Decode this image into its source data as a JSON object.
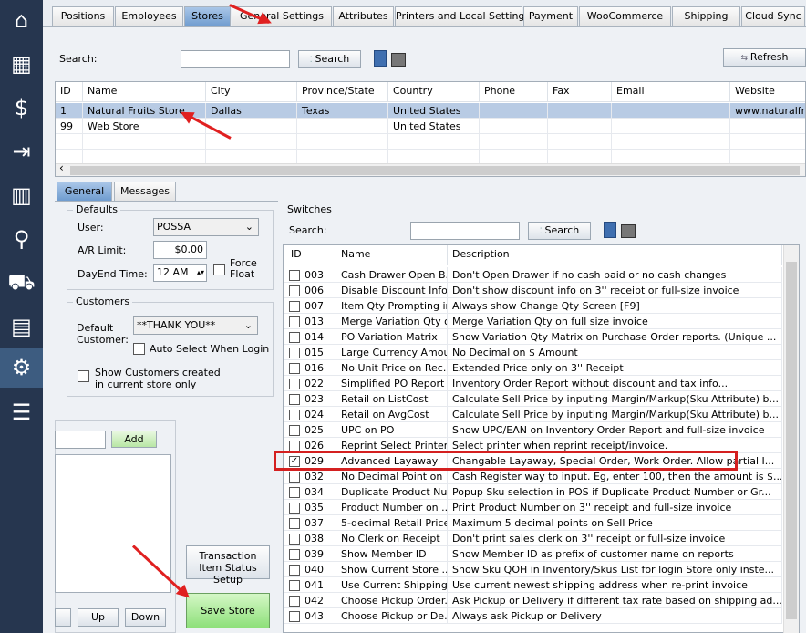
{
  "sidebar": {
    "items": [
      {
        "name": "home-icon",
        "glyph": "⌂"
      },
      {
        "name": "register-icon",
        "glyph": "▦"
      },
      {
        "name": "invoice-icon",
        "glyph": "$"
      },
      {
        "name": "signout-icon",
        "glyph": "⇥"
      },
      {
        "name": "building-icon",
        "glyph": "▥"
      },
      {
        "name": "walker-icon",
        "glyph": "⚲"
      },
      {
        "name": "delivery-icon",
        "glyph": "⛟"
      },
      {
        "name": "report-icon",
        "glyph": "▤"
      },
      {
        "name": "settings-icon",
        "glyph": "⚙"
      },
      {
        "name": "menu-icon",
        "glyph": "☰"
      }
    ]
  },
  "tabs": [
    "Positions",
    "Employees",
    "Stores",
    "General Settings",
    "Attributes",
    "Printers and Local Settings",
    "Payment",
    "WooCommerce",
    "Shipping",
    "Cloud Sync"
  ],
  "search_label": "Search:",
  "search_button": "Search",
  "refresh_button": "Refresh",
  "stores_table": {
    "columns": [
      "ID",
      "Name",
      "City",
      "Province/State",
      "Country",
      "Phone",
      "Fax",
      "Email",
      "Website"
    ],
    "rows": [
      [
        "1",
        "Natural Fruits Store",
        "Dallas",
        "Texas",
        "United States",
        "",
        "",
        "",
        "www.naturalfruits"
      ],
      [
        "99",
        "Web Store",
        "",
        "",
        "United States",
        "",
        "",
        "",
        ""
      ]
    ]
  },
  "subtabs": [
    "General",
    "Messages"
  ],
  "defaults": {
    "title": "Defaults",
    "user_label": "User:",
    "user_value": "POSSA",
    "ar_label": "A/R Limit:",
    "ar_value": "$0.00",
    "dayend_label": "DayEnd Time:",
    "dayend_value": "12 AM",
    "force_float": "Force Float"
  },
  "customers": {
    "title": "Customers",
    "default_label": "Default Customer:",
    "default_value": "**THANK YOU**",
    "auto_select": "Auto Select When Login",
    "show_customers": "Show Customers created in current store only"
  },
  "add_button": "Add",
  "up_button": "Up",
  "down_button": "Down",
  "transaction_button": "Transaction Item Status Setup",
  "save_button": "Save Store",
  "switches": {
    "title": "Switches",
    "search_label": "Search:",
    "search_button": "Search",
    "columns": [
      "ID",
      "Name",
      "Description"
    ],
    "rows": [
      {
        "checked": false,
        "id": "003",
        "name": "Cash Drawer Open B...",
        "desc": "Don't Open Drawer if no cash paid or no cash changes"
      },
      {
        "checked": false,
        "id": "006",
        "name": "Disable Discount Info",
        "desc": "Don't show discount info on 3'' receipt or full-size invoice"
      },
      {
        "checked": false,
        "id": "007",
        "name": "Item Qty Prompting in...",
        "desc": "Always show Change Qty Screen [F9]"
      },
      {
        "checked": false,
        "id": "013",
        "name": "Merge Variation Qty o...",
        "desc": "Merge Variation Qty on full size invoice"
      },
      {
        "checked": false,
        "id": "014",
        "name": "PO Variation Matrix",
        "desc": "Show Variation Qty Matrix on Purchase Order reports. (Unique ..."
      },
      {
        "checked": false,
        "id": "015",
        "name": "Large Currency Amount",
        "desc": "No Decimal on $ Amount"
      },
      {
        "checked": false,
        "id": "016",
        "name": "No Unit Price on Rec...",
        "desc": "Extended Price only on 3'' Receipt"
      },
      {
        "checked": false,
        "id": "022",
        "name": "Simplified PO Report",
        "desc": "Inventory Order Report without discount and tax info..."
      },
      {
        "checked": false,
        "id": "023",
        "name": "Retail on ListCost",
        "desc": "Calculate Sell Price by inputing Margin/Markup(Sku Attribute) b..."
      },
      {
        "checked": false,
        "id": "024",
        "name": "Retail on AvgCost",
        "desc": "Calculate Sell Price by inputing Margin/Markup(Sku Attribute) b..."
      },
      {
        "checked": false,
        "id": "025",
        "name": "UPC on PO",
        "desc": "Show UPC/EAN on Inventory Order Report and full-size invoice"
      },
      {
        "checked": false,
        "id": "026",
        "name": "Reprint Select Printer",
        "desc": "Select printer when reprint receipt/invoice."
      },
      {
        "checked": true,
        "id": "029",
        "name": "Advanced Layaway",
        "desc": "Changable Layaway, Special Order, Work Order. Allow partial I..."
      },
      {
        "checked": false,
        "id": "032",
        "name": "No Decimal Point on ...",
        "desc": "Cash Register way to input. Eg, enter 100, then the amount is $..."
      },
      {
        "checked": false,
        "id": "034",
        "name": "Duplicate Product Nu...",
        "desc": "Popup Sku selection in POS if Duplicate Product Number or Gr..."
      },
      {
        "checked": false,
        "id": "035",
        "name": "Product Number on ...",
        "desc": "Print Product Number on 3'' receipt and full-size invoice"
      },
      {
        "checked": false,
        "id": "037",
        "name": "5-decimal Retail Price",
        "desc": "Maximum 5 decimal points on Sell Price"
      },
      {
        "checked": false,
        "id": "038",
        "name": "No Clerk on Receipt",
        "desc": "Don't print sales clerk on 3'' receipt or full-size invoice"
      },
      {
        "checked": false,
        "id": "039",
        "name": "Show Member ID",
        "desc": "Show Member ID as prefix of customer name on reports"
      },
      {
        "checked": false,
        "id": "040",
        "name": "Show Current Store ...",
        "desc": "Show Sku QOH in Inventory/Skus List for login Store only inste..."
      },
      {
        "checked": false,
        "id": "041",
        "name": "Use Current Shipping...",
        "desc": "Use current newest shipping address when re-print invoice"
      },
      {
        "checked": false,
        "id": "042",
        "name": "Choose Pickup Order...",
        "desc": "Ask Pickup or Delivery if different tax rate based on shipping ad..."
      },
      {
        "checked": false,
        "id": "043",
        "name": "Choose Pickup or De...",
        "desc": "Always ask Pickup or Delivery"
      }
    ]
  },
  "colors": {
    "sidebar": "#26364f",
    "tab_selected": "#7fa8d8",
    "highlight": "#e02020",
    "save_green": "#8ee07a"
  }
}
